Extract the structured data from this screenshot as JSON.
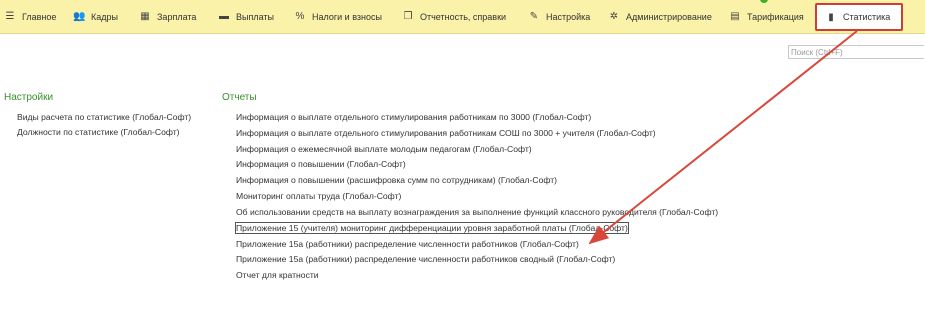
{
  "menu": {
    "items": [
      {
        "label": "Главное",
        "icon": "list-icon",
        "glyph": "☰"
      },
      {
        "label": "Кадры",
        "icon": "people-icon",
        "glyph": "👥"
      },
      {
        "label": "Зарплата",
        "icon": "calculator-icon",
        "glyph": "▦"
      },
      {
        "label": "Выплаты",
        "icon": "card-icon",
        "glyph": "▬"
      },
      {
        "label": "Налоги и взносы",
        "icon": "percent-icon",
        "glyph": "%"
      },
      {
        "label": "Отчетность, справки",
        "icon": "documents-icon",
        "glyph": "❐"
      },
      {
        "label": "Настройка",
        "icon": "wrench-icon",
        "glyph": "✎"
      },
      {
        "label": "Администрирование",
        "icon": "gear-icon",
        "glyph": "✲"
      },
      {
        "label": "Тарификация",
        "icon": "tariff-doc-icon",
        "glyph": "▤"
      },
      {
        "label": "Статистика",
        "icon": "bar-chart-icon",
        "glyph": "▮",
        "active": true
      }
    ]
  },
  "search": {
    "placeholder": "Поиск (Ctrl+F)"
  },
  "settings": {
    "title": "Настройки",
    "items": [
      "Виды расчета по статистике (Глобал-Софт)",
      "Должности по статистике (Глобал-Софт)"
    ]
  },
  "reports": {
    "title": "Отчеты",
    "items": [
      "Информация о выплате отдельного стимулирования работникам по 3000 (Глобал-Софт)",
      "Информация о выплате отдельного стимулирования работникам СОШ по 3000 + учителя (Глобал-Софт)",
      "Информация о ежемесячной выплате молодым педагогам (Глобал-Софт)",
      "Информация о повышении  (Глобал-Софт)",
      "Информация о повышении (расшифровка сумм по сотрудникам) (Глобал-Софт)",
      "Мониторинг оплаты труда (Глобал-Софт)",
      "Об использовании средств на выплату вознаграждения за выполнение функций классного руководителя (Глобал-Софт)",
      "Приложение 15 (учителя) мониторинг дифференциации уровня заработной платы (Глобал-Софт)",
      "Приложение 15а (работники) распределение численности работников (Глобал-Софт)",
      "Приложение 15а (работники) распределение численности работников сводный (Глобал-Софт)",
      "Отчет для кратности"
    ],
    "highlighted_index": 7
  },
  "annotation": {
    "arrow_color": "#d9473a",
    "box_color": "#cc3f32"
  }
}
